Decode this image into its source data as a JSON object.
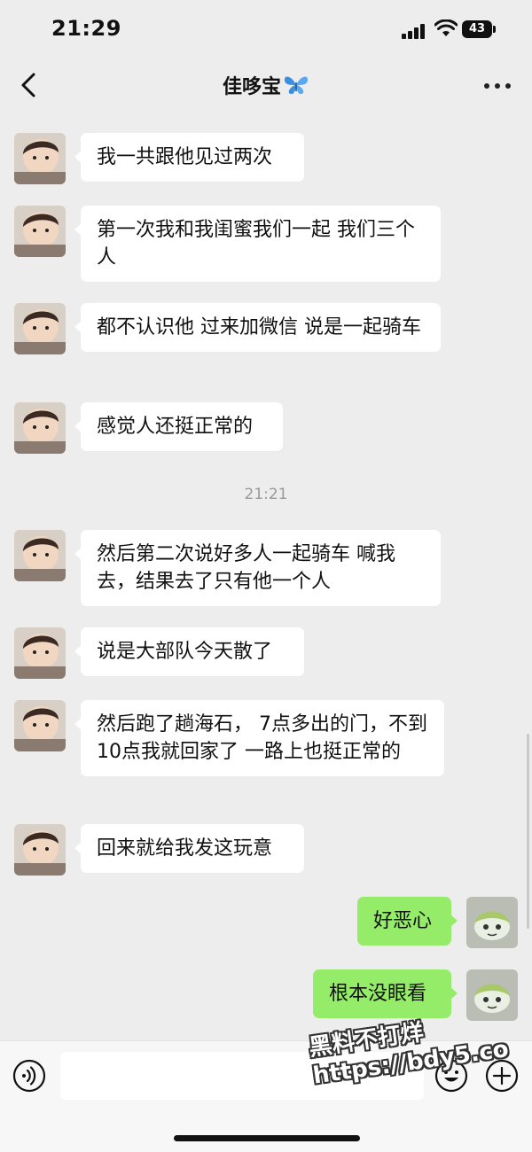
{
  "status_bar": {
    "time": "21:29",
    "battery": "43"
  },
  "chat": {
    "title": "佳哆宝"
  },
  "messages": [
    {
      "side": "in",
      "text": "我一共跟他见过两次"
    },
    {
      "side": "in",
      "text": "第一次我和我闺蜜我们一起 我们三个人"
    },
    {
      "side": "in",
      "text": "都不认识他 过来加微信 说是一起骑车"
    },
    {
      "side": "in",
      "text": "感觉人还挺正常的"
    },
    {
      "type": "timestamp",
      "text": "21:21"
    },
    {
      "side": "in",
      "text": "然后第二次说好多人一起骑车 喊我去，结果去了只有他一个人"
    },
    {
      "side": "in",
      "text": "说是大部队今天散了"
    },
    {
      "side": "in",
      "text": "然后跑了趟海石， 7点多出的门，不到10点我就回家了 一路上也挺正常的"
    },
    {
      "side": "in",
      "text": "回来就给我发这玩意"
    },
    {
      "side": "out",
      "text": "好恶心"
    },
    {
      "side": "out",
      "text": "根本没眼看"
    }
  ],
  "watermark": {
    "line1": "黑料不打烊",
    "line2": "https://bdy5.co"
  },
  "colors": {
    "background": "#ededed",
    "outgoing_bubble": "#95ec69",
    "incoming_bubble": "#ffffff"
  },
  "icons": [
    "back-arrow-icon",
    "butterfly-icon",
    "more-icon",
    "voice-icon",
    "emoji-icon",
    "plus-icon"
  ]
}
